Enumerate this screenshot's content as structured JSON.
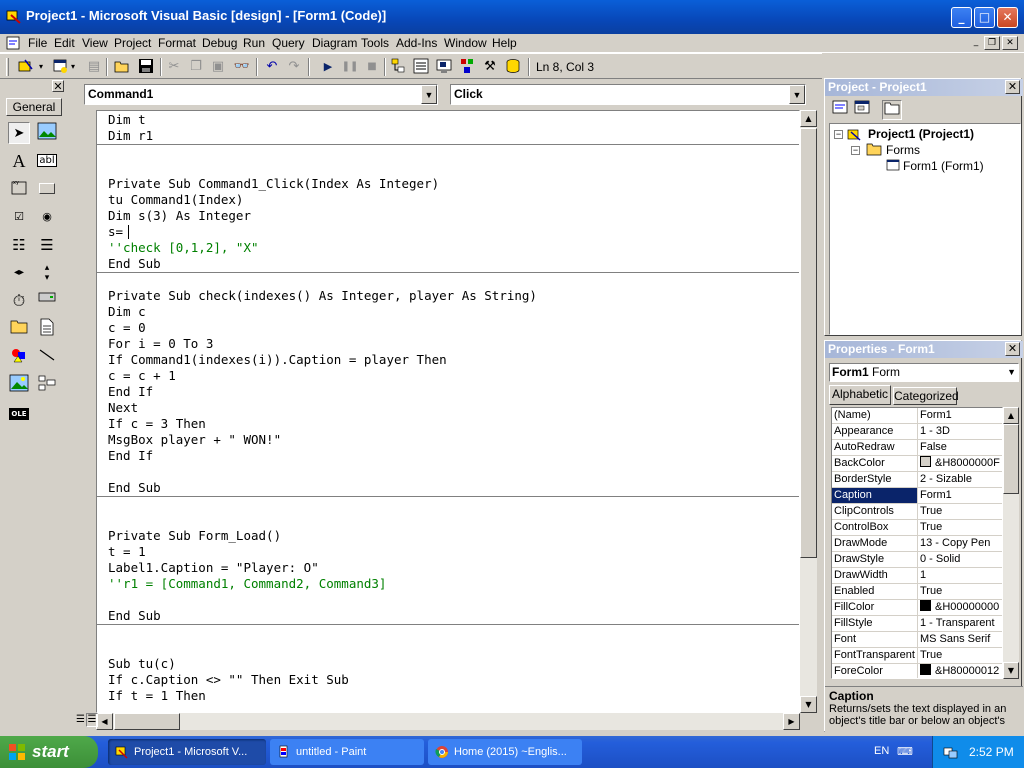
{
  "window": {
    "title": "Project1 - Microsoft Visual Basic [design] - [Form1 (Code)]",
    "minimize_glyph": "_",
    "maximize_glyph": "□",
    "close_glyph": "✕"
  },
  "menu": [
    "File",
    "Edit",
    "View",
    "Project",
    "Format",
    "Debug",
    "Run",
    "Query",
    "Diagram",
    "Tools",
    "Add-Ins",
    "Window",
    "Help"
  ],
  "toolbar": {
    "position_label": "Ln 8, Col 3"
  },
  "toolbox": {
    "tab_label": "General",
    "close_glyph": "✕"
  },
  "code_window": {
    "object_combo": "Command1",
    "procedure_combo": "Click",
    "lines": [
      {
        "text": "Dim t",
        "type": "code"
      },
      {
        "text": "Dim r1",
        "type": "code"
      },
      {
        "text": "Private Sub Command1_Click(Index As Integer)",
        "type": "code"
      },
      {
        "text": "tu Command1(Index)",
        "type": "code"
      },
      {
        "text": "Dim s(3) As Integer",
        "type": "code"
      },
      {
        "text": "s=",
        "type": "code"
      },
      {
        "text": "''check [0,1,2], \"X\"",
        "type": "comment"
      },
      {
        "text": "End Sub",
        "type": "code"
      },
      {
        "text": "Private Sub check(indexes() As Integer, player As String)",
        "type": "code"
      },
      {
        "text": "Dim c",
        "type": "code"
      },
      {
        "text": "c = 0",
        "type": "code"
      },
      {
        "text": "For i = 0 To 3",
        "type": "code"
      },
      {
        "text": "If Command1(indexes(i)).Caption = player Then",
        "type": "code"
      },
      {
        "text": "c = c + 1",
        "type": "code"
      },
      {
        "text": "End If",
        "type": "code"
      },
      {
        "text": "Next",
        "type": "code"
      },
      {
        "text": "If c = 3 Then",
        "type": "code"
      },
      {
        "text": "MsgBox player + \" WON!\"",
        "type": "code"
      },
      {
        "text": "End If",
        "type": "code"
      },
      {
        "text": "End Sub",
        "type": "code"
      },
      {
        "text": "Private Sub Form_Load()",
        "type": "code"
      },
      {
        "text": "t = 1",
        "type": "code"
      },
      {
        "text": "Label1.Caption = \"Player: O\"",
        "type": "code"
      },
      {
        "text": "''r1 = [Command1, Command2, Command3]",
        "type": "comment"
      },
      {
        "text": "End Sub",
        "type": "code"
      },
      {
        "text": "Sub tu(c)",
        "type": "code"
      },
      {
        "text": "If c.Caption <> \"\" Then Exit Sub",
        "type": "code"
      },
      {
        "text": "If t = 1 Then",
        "type": "code"
      }
    ]
  },
  "project_panel": {
    "title": "Project - Project1",
    "tree": [
      {
        "label": "Project1 (Project1)",
        "bold": true
      },
      {
        "label": "Forms",
        "bold": false
      },
      {
        "label": "Form1 (Form1)",
        "bold": false
      }
    ]
  },
  "properties_panel": {
    "title": "Properties - Form1",
    "object_name": "Form1",
    "object_type": "Form",
    "tabs": [
      "Alphabetic",
      "Categorized"
    ],
    "rows": [
      {
        "name": "(Name)",
        "value": "Form1"
      },
      {
        "name": "Appearance",
        "value": "1 - 3D"
      },
      {
        "name": "AutoRedraw",
        "value": "False"
      },
      {
        "name": "BackColor",
        "value": "&H8000000F",
        "swatch": "#d4d0c8"
      },
      {
        "name": "BorderStyle",
        "value": "2 - Sizable"
      },
      {
        "name": "Caption",
        "value": "Form1",
        "selected": true
      },
      {
        "name": "ClipControls",
        "value": "True"
      },
      {
        "name": "ControlBox",
        "value": "True"
      },
      {
        "name": "DrawMode",
        "value": "13 - Copy Pen"
      },
      {
        "name": "DrawStyle",
        "value": "0 - Solid"
      },
      {
        "name": "DrawWidth",
        "value": "1"
      },
      {
        "name": "Enabled",
        "value": "True"
      },
      {
        "name": "FillColor",
        "value": "&H00000000",
        "swatch": "#000000"
      },
      {
        "name": "FillStyle",
        "value": "1 - Transparent"
      },
      {
        "name": "Font",
        "value": "MS Sans Serif"
      },
      {
        "name": "FontTransparent",
        "value": "True"
      },
      {
        "name": "ForeColor",
        "value": "&H80000012",
        "swatch": "#000000"
      }
    ],
    "description_title": "Caption",
    "description_text": "Returns/sets the text displayed in an object's title bar or below an object's"
  },
  "taskbar": {
    "start_label": "start",
    "tasks": [
      {
        "label": "Project1 - Microsoft V...",
        "active": true
      },
      {
        "label": "untitled - Paint",
        "active": false
      },
      {
        "label": "Home (2015) ~Englis...",
        "active": false
      }
    ],
    "language": "EN",
    "clock": "2:52 PM"
  },
  "colors": {
    "title_blue": "#0a5fd8",
    "comment_green": "#008000",
    "selection_navy": "#0a246a",
    "taskbar_blue": "#245edb",
    "start_green": "#3c8f38"
  }
}
